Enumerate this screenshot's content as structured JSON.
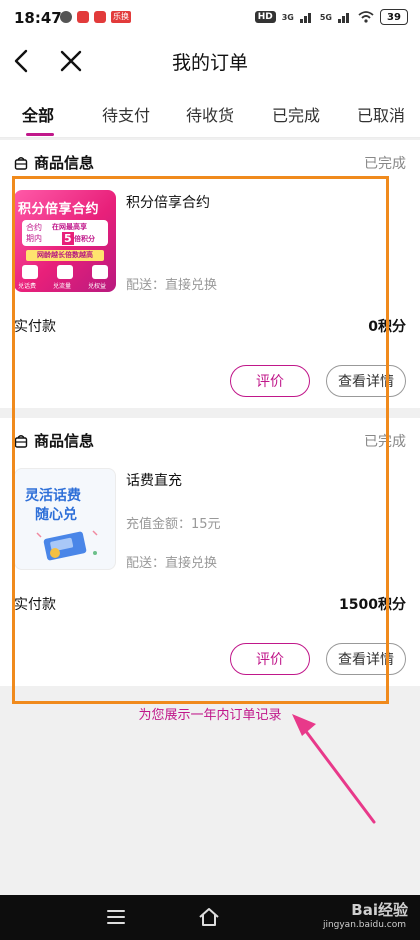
{
  "status_bar": {
    "time": "18:47",
    "hd_label": "HD",
    "net_3g": "3G",
    "net_5g": "5G",
    "battery": "39",
    "notif_badge": "乐换"
  },
  "nav": {
    "title": "我的订单"
  },
  "tabs": [
    {
      "label": "全部",
      "active": true
    },
    {
      "label": "待支付"
    },
    {
      "label": "待收货"
    },
    {
      "label": "已完成"
    },
    {
      "label": "已取消"
    }
  ],
  "orders": [
    {
      "section_title": "商品信息",
      "status": "已完成",
      "product_name": "积分倍享合约",
      "lines": [
        "配送：直接兑换"
      ],
      "pay_label": "实付款",
      "pay_value": "0积分",
      "review_label": "评价",
      "detail_label": "查看详情",
      "thumb": {
        "headline": "积分倍享合约",
        "box_left_1": "合约",
        "box_left_2": "期内",
        "box_right_1": "在网最高享",
        "box_right_2": "倍积分",
        "box_num": "5",
        "banner": "网龄越长倍数越高",
        "icons": [
          "兑话费",
          "兑流量",
          "兑权益"
        ]
      }
    },
    {
      "section_title": "商品信息",
      "status": "已完成",
      "product_name": "话费直充",
      "lines": [
        "充值金额：15元",
        "配送：直接兑换"
      ],
      "pay_label": "实付款",
      "pay_value": "1500积分",
      "review_label": "评价",
      "detail_label": "查看详情",
      "thumb": {
        "line1": "灵活话费",
        "line2": "随心兑"
      }
    }
  ],
  "footer_note": "为您展示一年内订单记录",
  "watermark": {
    "main": "Bai经验",
    "sub": "jingyan.baidu.com"
  },
  "colors": {
    "accent": "#c0178a",
    "highlight": "#f08a1c",
    "arrow": "#e8398a"
  }
}
